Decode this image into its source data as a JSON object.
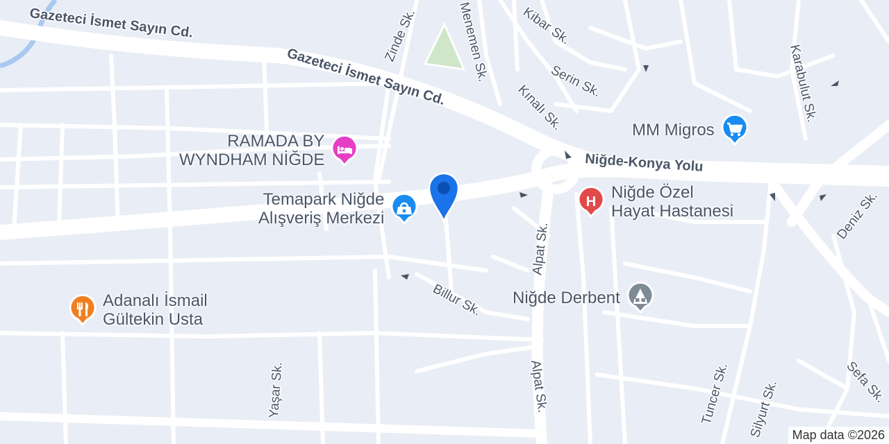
{
  "colors": {
    "background": "#e9edf6",
    "road": "#ffffff",
    "park": "#cfe6c9",
    "water": "#a9c8f0",
    "label": "#4a5668",
    "hotel": "#e63fc6",
    "shopping": "#1a8cf0",
    "hospital": "#e24a4a",
    "restaurant": "#f07f22",
    "landmark": "#7d8b96",
    "location_pin": "#1a73e8"
  },
  "streets": {
    "gazeteci_1": "Gazeteci İsmet Sayın Cd.",
    "gazeteci_2": "Gazeteci İsmet Sayın Cd.",
    "nigde_konya": "Niğde-Konya Yolu",
    "zinde": "Zinde Sk.",
    "menemen": "Menemen Sk.",
    "kibar": "Kibar Sk.",
    "serin": "Serin Sk.",
    "kinali": "Kınalı Sk.",
    "karabulut": "Karabulut Sk.",
    "alpat_1": "Alpat Sk.",
    "alpat_2": "Alpat Sk.",
    "billur": "Billur Sk.",
    "yasar": "Yaşar Sk.",
    "tuncer": "Tuncer Sk.",
    "silyurt": "Silyurt Sk.",
    "sefa": "Sefa Sk.",
    "deniz": "Deniz Sk."
  },
  "pois": {
    "ramada": {
      "line1": "RAMADA BY",
      "line2": "WYNDHAM NİĞDE",
      "icon": "hotel-bed-icon"
    },
    "temapark": {
      "line1": "Temapark Niğde",
      "line2": "Alışveriş Merkezi",
      "icon": "shopping-bag-icon"
    },
    "migros": {
      "line1": "MM Migros",
      "icon": "shopping-cart-icon"
    },
    "hospital": {
      "line1": "Niğde Özel",
      "line2": "Hayat Hastanesi",
      "icon": "hospital-icon"
    },
    "adanali": {
      "line1": "Adanalı İsmail",
      "line2": "Gültekin Usta",
      "icon": "restaurant-icon"
    },
    "derbent": {
      "line1": "Niğde Derbent",
      "icon": "monument-icon"
    }
  },
  "attribution": "Map data ©2026"
}
